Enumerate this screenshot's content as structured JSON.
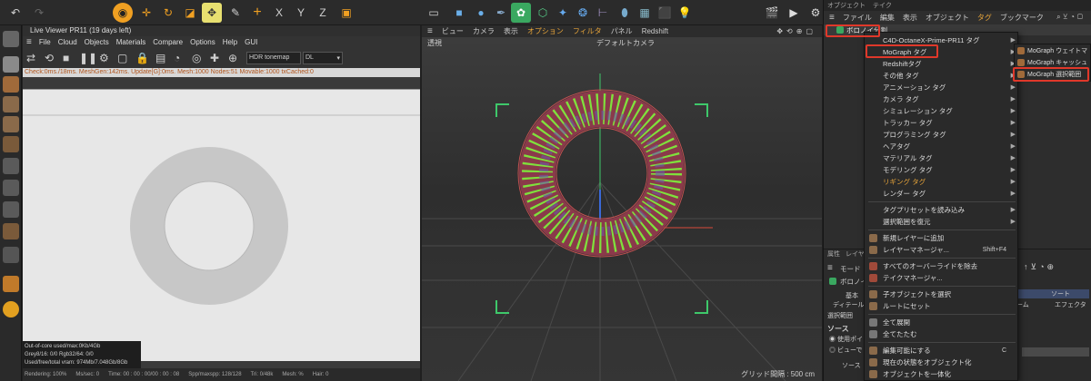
{
  "toolbar": {
    "icons": [
      "undo-icon",
      "redo-icon",
      "live-selection-icon",
      "move-icon",
      "rotate-icon",
      "scale-icon",
      "axis-icon",
      "tweak-icon",
      "plus-icon",
      "x-axis-icon",
      "y-axis-icon",
      "z-axis-icon",
      "coordinate-icon"
    ],
    "axis_x": "X",
    "axis_y": "Y",
    "axis_z": "Z"
  },
  "live_viewer": {
    "title": "Live Viewer PR11 (19 days left)",
    "menu": [
      "File",
      "Cloud",
      "Objects",
      "Materials",
      "Compare",
      "Options",
      "Help",
      "GUI"
    ],
    "tonemap": "HDR tonemap",
    "kernel": "DL",
    "status": "Check:0ms./18ms. MeshGen:142ms. Update[G]:0ms. Mesh:1000 Nodes:51 Movable:1000 txCached:0",
    "stats": [
      "Out-of-core used/max:0Kb/4Gb",
      "Grey8/16: 0/0       Rgb32/64: 0/0",
      "Used/free/total vram: 974Mb/7.048Gb/8Gb"
    ],
    "footer": [
      "Rendering: 100%",
      "Ms/sec: 0",
      "Time: 00 : 00 : 00/00 : 00 : 08",
      "Spp/maxspp: 128/128",
      "Tri: 0/48k",
      "Mesh: %",
      "Hair: 0"
    ]
  },
  "viewport": {
    "menu": [
      "ビュー",
      "カメラ",
      "表示",
      "オプション",
      "フィルタ",
      "パネル",
      "Redshift"
    ],
    "mode": "透視",
    "camera": "デフォルトカメラ",
    "grid": "グリッド間隔 : 500 cm",
    "colors": {
      "torus": "#8a3a4a",
      "points": "#7cff3a",
      "axis_y": "#3ec86a",
      "axis_x": "#d84a3a",
      "axis_z": "#3a6ad8"
    }
  },
  "right_panel": {
    "tabs": [
      "オブジェクト",
      "テイク"
    ],
    "menu": [
      "ファイル",
      "編集",
      "表示",
      "オブジェクト",
      "タグ",
      "ブックマーク"
    ],
    "object_name": "ボロノイ分割",
    "attr_tabs": [
      "属性",
      "レイヤ"
    ],
    "mode_label": "モード",
    "object_label": "ボロノイ分",
    "basic_tab": "基本",
    "sort_tab": "ソート",
    "effector_tab": "エフェクタ",
    "display_label": "ディテール",
    "select_label": "選択範囲",
    "source_label": "ソース",
    "use_point": "使用ポイ",
    "view_label": "ビューで",
    "source2": "ソース",
    "frame_label": "ーム"
  },
  "tag_menu": {
    "items": [
      {
        "label": "C4D-OctaneX-Prime-PR11 タグ",
        "arrow": true
      },
      {
        "label": "MoGraph タグ",
        "arrow": true
      },
      {
        "label": "Redshiftタグ",
        "arrow": true
      },
      {
        "label": "その他 タグ",
        "arrow": true
      },
      {
        "label": "アニメーション タグ",
        "arrow": true
      },
      {
        "label": "カメラ タグ",
        "arrow": true
      },
      {
        "label": "シミュレーション タグ",
        "arrow": true
      },
      {
        "label": "トラッカー タグ",
        "arrow": true
      },
      {
        "label": "プログラミング タグ",
        "arrow": true
      },
      {
        "label": "ヘアタグ",
        "arrow": true
      },
      {
        "label": "マテリアル タグ",
        "arrow": true
      },
      {
        "label": "モデリング タグ",
        "arrow": true
      },
      {
        "label": "リギング タグ",
        "arrow": true
      },
      {
        "label": "レンダー タグ",
        "arrow": true
      },
      {
        "label": "タグプリセットを読み込み",
        "arrow": true
      },
      {
        "label": "選択範囲を復元",
        "arrow": true
      },
      {
        "label": "新規レイヤーに追加",
        "arrow": false
      },
      {
        "label": "レイヤーマネージャ...",
        "arrow": false,
        "shortcut": "Shift+F4"
      },
      {
        "label": "すべてのオーバーライドを除去",
        "arrow": false
      },
      {
        "label": "テイクマネージャ...",
        "arrow": false
      },
      {
        "label": "子オブジェクトを選択",
        "arrow": false
      },
      {
        "label": "ルートにセット",
        "arrow": false
      },
      {
        "label": "全て展開",
        "arrow": false
      },
      {
        "label": "全てたたむ",
        "arrow": false
      },
      {
        "label": "編集可能にする",
        "arrow": false,
        "shortcut": "C"
      },
      {
        "label": "現在の状態をオブジェクト化",
        "arrow": false
      },
      {
        "label": "オブジェクトを一体化",
        "arrow": false
      }
    ]
  },
  "mograph_submenu": {
    "items": [
      "MoGraph ウェイトマ",
      "MoGraph キャッシュ",
      "MoGraph 選択範囲"
    ]
  }
}
